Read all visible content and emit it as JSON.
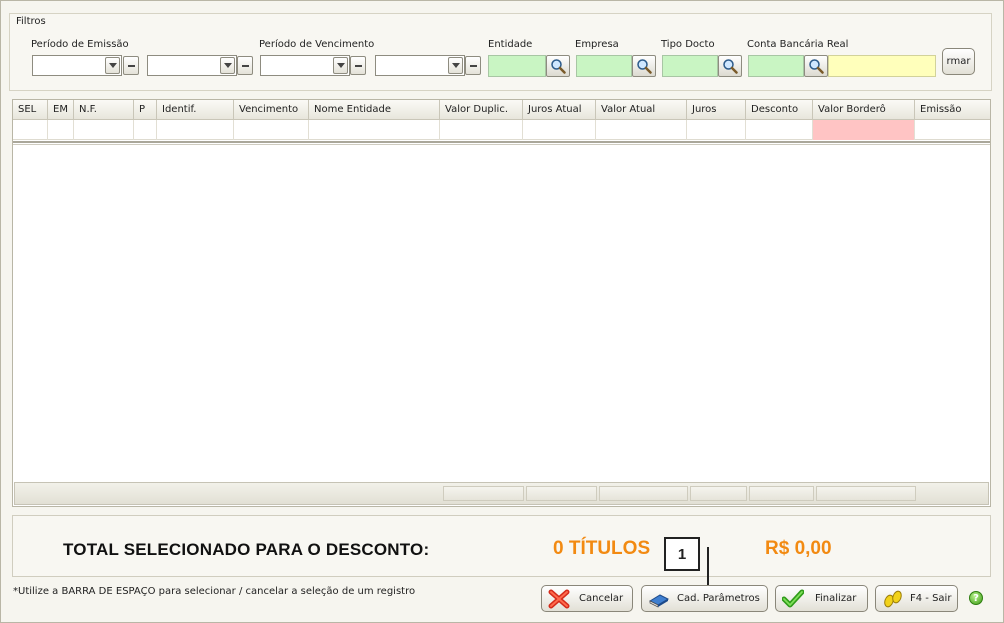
{
  "filters": {
    "title": "Filtros",
    "emissao_label": "Período de Emissão",
    "vencimento_label": "Período de Vencimento",
    "entidade_label": "Entidade",
    "empresa_label": "Empresa",
    "tipo_docto_label": "Tipo Docto",
    "conta_label": "Conta Bancária Real",
    "confirm_label": "rmar"
  },
  "grid": {
    "columns": [
      "SEL",
      "EM",
      "N.F.",
      "P",
      "Identif.",
      "Vencimento",
      "Nome Entidade",
      "Valor Duplic.",
      "Juros Atual",
      "Valor Atual",
      "Juros",
      "Desconto",
      "Valor Borderô",
      "Emissão"
    ]
  },
  "total": {
    "label": "TOTAL SELECIONADO PARA O DESCONTO:",
    "count": "0 TÍTULOS",
    "value": "R$ 0,00"
  },
  "callout": "1",
  "hint": "*Utilize a BARRA DE ESPAÇO para selecionar / cancelar a seleção de um registro",
  "buttons": {
    "cancel": "Cancelar",
    "params": "Cad. Parâmetros",
    "finish": "Finalizar",
    "exit": "F4 - Sair",
    "help": "?"
  },
  "colors": {
    "accent_orange": "#f28a12",
    "lookup_green": "#c9f5c3",
    "highlight_pink": "#ffc4c4",
    "field_yellow": "#ffffbb"
  },
  "icons": {
    "lookup": "magnifier-icon",
    "cancel": "red-x-icon",
    "params": "blue-book-icon",
    "finish": "green-check-icon",
    "exit": "footprints-icon",
    "help": "help-icon"
  }
}
